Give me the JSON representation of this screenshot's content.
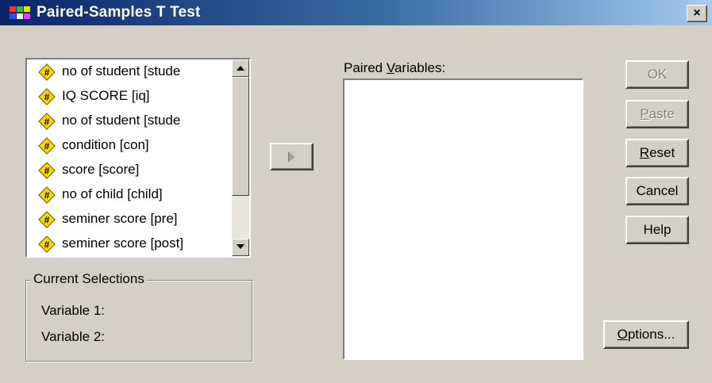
{
  "window": {
    "title": "Paired-Samples T Test",
    "close_label": "×"
  },
  "variables": [
    {
      "label": "no of student [stude",
      "icon": "numeric-variable-icon"
    },
    {
      "label": "IQ SCORE [iq]",
      "icon": "numeric-variable-icon"
    },
    {
      "label": "no of student [stude",
      "icon": "numeric-variable-icon"
    },
    {
      "label": "condition [con]",
      "icon": "numeric-variable-icon"
    },
    {
      "label": "score [score]",
      "icon": "numeric-variable-icon"
    },
    {
      "label": "no of child [child]",
      "icon": "numeric-variable-icon"
    },
    {
      "label": "seminer score [pre]",
      "icon": "numeric-variable-icon"
    },
    {
      "label": "seminer score [post]",
      "icon": "numeric-variable-icon"
    }
  ],
  "current_selections": {
    "legend": "Current Selections",
    "variable1_label": "Variable 1:",
    "variable2_label": "Variable 2:"
  },
  "paired": {
    "label_pre": "Paired ",
    "label_mnemonic": "V",
    "label_post": "ariables:"
  },
  "buttons": {
    "ok": "OK",
    "paste_mnemonic": "P",
    "paste_rest": "aste",
    "reset_mnemonic": "R",
    "reset_rest": "eset",
    "cancel": "Cancel",
    "help": "Help",
    "options_mnemonic": "O",
    "options_rest": "ptions..."
  },
  "colors": {
    "titlebar_start": "#0a246a",
    "titlebar_end": "#a6caf0",
    "dialog_bg": "#d4d0c8",
    "icon_fill": "#ffd800"
  }
}
